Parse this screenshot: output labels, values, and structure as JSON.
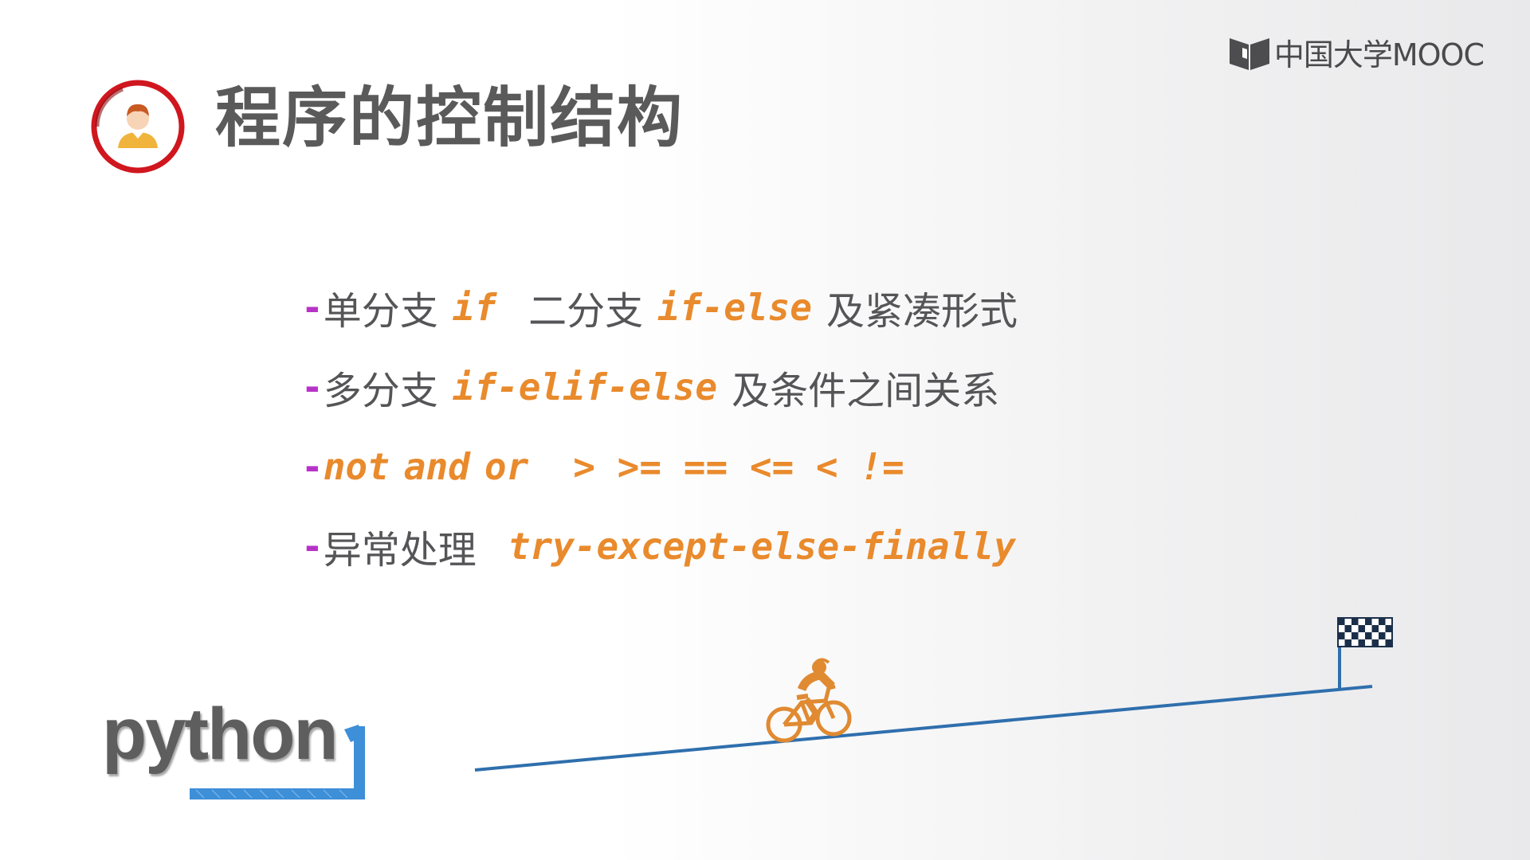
{
  "brand": {
    "logo_text": "中国大学MOOC"
  },
  "header": {
    "title": "程序的控制结构"
  },
  "bullets": [
    {
      "dash": "-",
      "zh1": "单分支",
      "code1": "if",
      "zh2": "二分支",
      "code2": "if-else",
      "zh3": "及紧凑形式"
    },
    {
      "dash": "-",
      "zh1": "多分支",
      "code1": "if-elif-else",
      "zh2": "及条件之间关系"
    },
    {
      "dash": "-",
      "code1": "not",
      "code2": "and",
      "code3": "or",
      "code4": "> >= == <= < !="
    },
    {
      "dash": "-",
      "zh1": "异常处理",
      "code1": "try-except-else-finally"
    }
  ],
  "python_logo": {
    "text": "python"
  },
  "colors": {
    "dash": "#b832c8",
    "code": "#e98a2c",
    "text": "#555558",
    "title": "#5a5a5a",
    "road": "#2f6fad",
    "cyclist": "#e08a32",
    "avatar_ring": "#d0161e",
    "python_blue": "#3d8fd8"
  },
  "icons": [
    "mooc-logo-icon",
    "avatar-icon",
    "cyclist-icon",
    "checkered-flag-icon",
    "python-logo"
  ]
}
